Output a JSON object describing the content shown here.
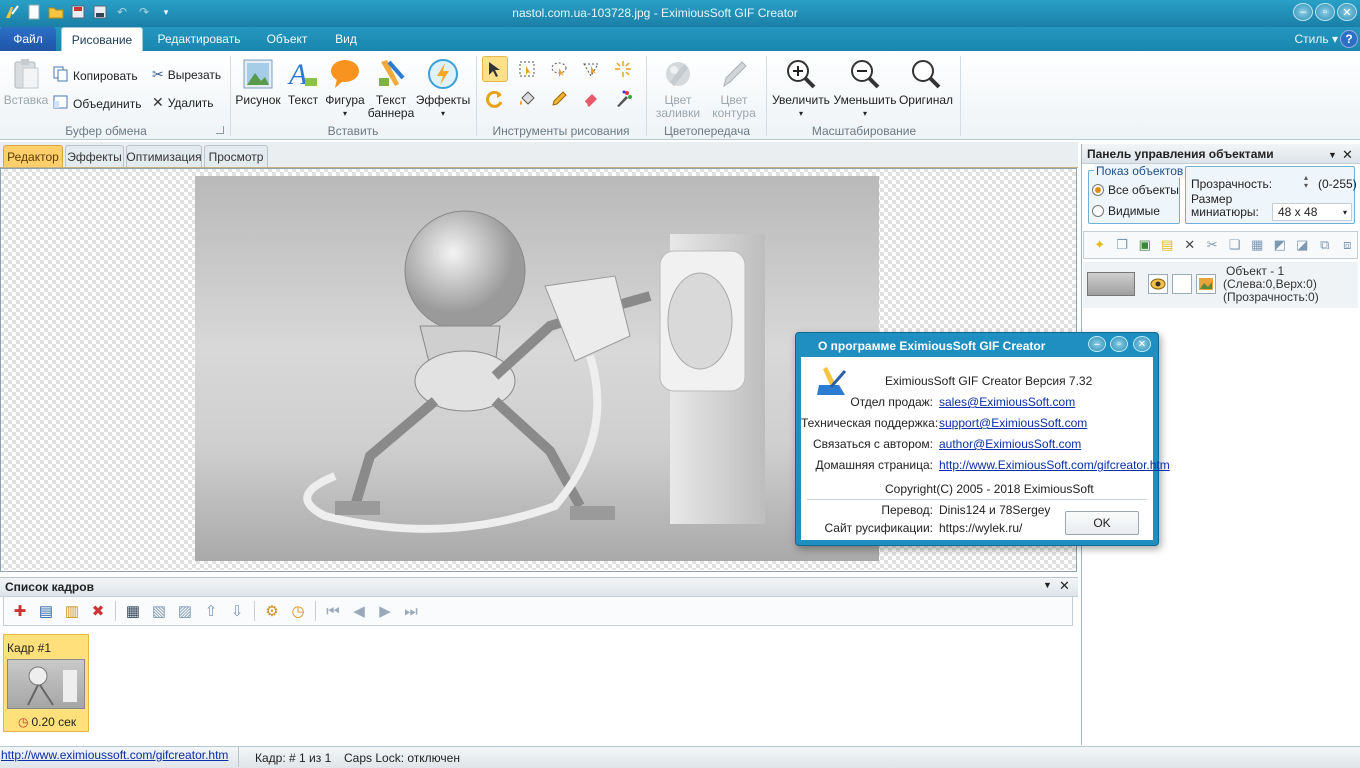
{
  "window": {
    "title": "nastol.com.ua-103728.jpg - EximiousSoft GIF Creator",
    "minimize_icon": "minimize-icon",
    "maximize_icon": "restore-icon",
    "close_icon": "close-icon"
  },
  "quick_access": [
    "app-logo-icon",
    "new-icon",
    "open-icon",
    "save-icon",
    "save-as-icon",
    "undo-icon",
    "redo-icon",
    "customize-icon"
  ],
  "ribbon_tabs": [
    {
      "label": "Файл"
    },
    {
      "label": "Рисование",
      "active": true
    },
    {
      "label": "Редактировать"
    },
    {
      "label": "Объект"
    },
    {
      "label": "Вид"
    }
  ],
  "style_label": "Стиль",
  "help_label": "?",
  "ribbon": {
    "clipboard": {
      "paste": "Вставка",
      "copy": "Копировать",
      "merge": "Объединить",
      "cut": "Вырезать",
      "delete": "Удалить",
      "group": "Буфер обмена"
    },
    "insert": {
      "picture": "Рисунок",
      "text": "Текст",
      "shape": "Фигура",
      "banner_text_1": "Текст",
      "banner_text_2": "баннера",
      "effects": "Эффекты",
      "group": "Вставить"
    },
    "draw_tools": {
      "group": "Инструменты рисования"
    },
    "color": {
      "fill_1": "Цвет",
      "fill_2": "заливки",
      "outline_1": "Цвет",
      "outline_2": "контура",
      "group": "Цветопередача"
    },
    "zoom": {
      "zoom_in": "Увеличить",
      "zoom_out": "Уменьшить",
      "original": "Оригинал",
      "group": "Масштабирование"
    }
  },
  "doc_tabs": [
    {
      "label": "Редактор",
      "active": true
    },
    {
      "label": "Эффекты"
    },
    {
      "label": "Оптимизация"
    },
    {
      "label": "Просмотр"
    }
  ],
  "frames_panel": {
    "title": "Список кадров",
    "frame": {
      "label": "Кадр #1",
      "delay": "0.20 сек"
    }
  },
  "objects_panel": {
    "title": "Панель управления объектами",
    "show_objects_legend": "Показ объектов",
    "all_objects": "Все объекты",
    "visible_only": "Видимые",
    "opacity_label": "Прозрачность:",
    "opacity_range": "(0-255)",
    "thumb_size_label_1": "Размер",
    "thumb_size_label_2": "миниатюры:",
    "thumb_size_value": "48 x 48",
    "object": {
      "name": "Объект - 1",
      "position": "(Слева:0,Верх:0)",
      "opacity": "(Прозрачность:0)"
    }
  },
  "status_bar": {
    "url": "http://www.eximioussoft.com/gifcreator.htm",
    "frame": "Кадр: # 1 из 1",
    "caps": "Caps Lock: отключен"
  },
  "about_dialog": {
    "title": "О программе EximiousSoft GIF Creator",
    "version_line": "EximiousSoft GIF Creator Версия  7.32",
    "sales_label": "Отдел продаж:",
    "sales_value": "sales@EximiousSoft.com",
    "support_label": "Техническая поддержка:",
    "support_value": "support@EximiousSoft.com",
    "author_label": "Связаться с автором:",
    "author_value": "author@EximiousSoft.com",
    "home_label": "Домашняя страница:",
    "home_value": "http://www.EximiousSoft.com/gifcreator.htm",
    "copyright": "Copyright(C) 2005 - 2018  EximiousSoft",
    "translation_label": "Перевод:",
    "translation_value": "Dinis124 и 78Sergey",
    "rus_site_label": "Сайт русификации:",
    "rus_site_value": "https://wylek.ru/",
    "ok": "OK"
  },
  "colors": {
    "title_bar": "#1a7fa6",
    "accent_orange": "#ffcf6b",
    "link": "#0b2fa8"
  }
}
